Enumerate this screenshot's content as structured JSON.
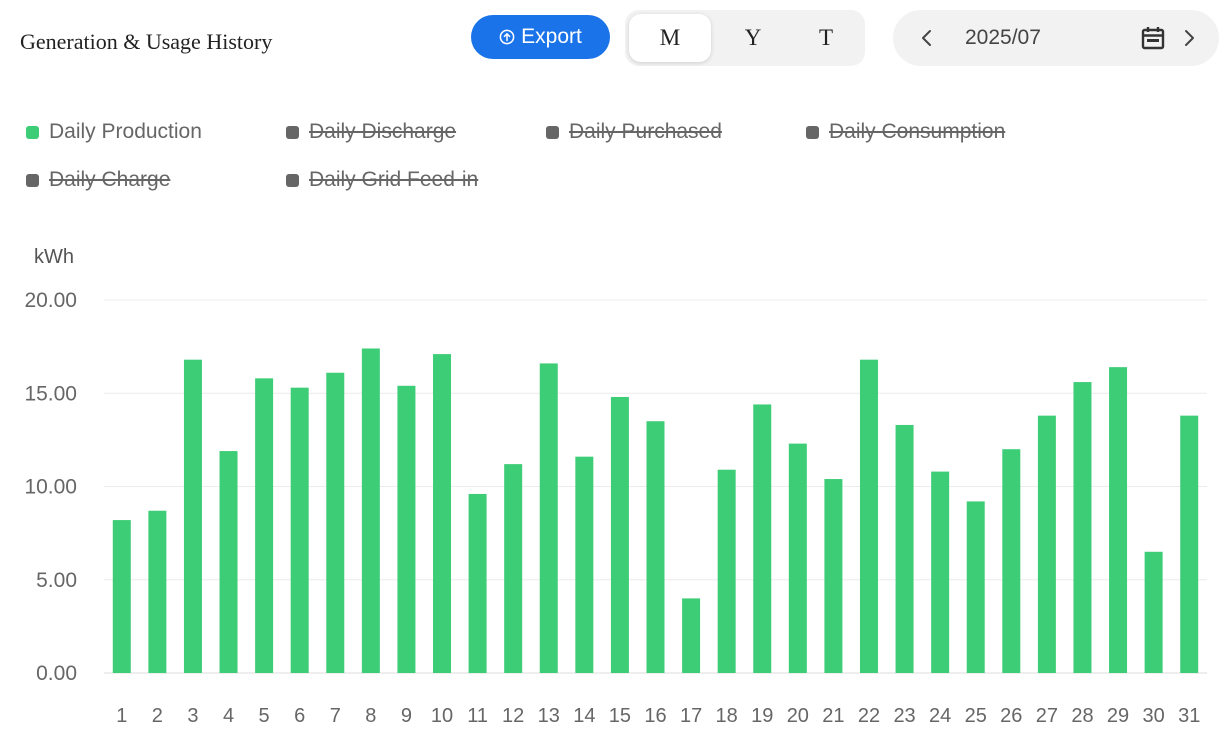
{
  "header": {
    "title": "Generation & Usage History",
    "export_label": "Export",
    "periods": [
      "M",
      "Y",
      "T"
    ],
    "active_period": "M",
    "date": "2025/07"
  },
  "legend": [
    {
      "label": "Daily Production",
      "color": "#3ecd77",
      "enabled": true
    },
    {
      "label": "Daily Discharge",
      "color": "#666666",
      "enabled": false
    },
    {
      "label": "Daily Purchased",
      "color": "#666666",
      "enabled": false
    },
    {
      "label": "Daily Consumption",
      "color": "#666666",
      "enabled": false
    },
    {
      "label": "Daily Charge",
      "color": "#666666",
      "enabled": false
    },
    {
      "label": "Daily Grid Feed-in",
      "color": "#666666",
      "enabled": false
    }
  ],
  "chart_data": {
    "type": "bar",
    "ylabel": "kWh",
    "ylim": [
      0,
      20
    ],
    "yticks": [
      "0.00",
      "5.00",
      "10.00",
      "15.00",
      "20.00"
    ],
    "categories": [
      "1",
      "2",
      "3",
      "4",
      "5",
      "6",
      "7",
      "8",
      "9",
      "10",
      "11",
      "12",
      "13",
      "14",
      "15",
      "16",
      "17",
      "18",
      "19",
      "20",
      "21",
      "22",
      "23",
      "24",
      "25",
      "26",
      "27",
      "28",
      "29",
      "30",
      "31"
    ],
    "series": [
      {
        "name": "Daily Production",
        "color": "#3ecd77",
        "values": [
          8.2,
          8.7,
          16.8,
          11.9,
          15.8,
          15.3,
          16.1,
          17.4,
          15.4,
          17.1,
          9.6,
          11.2,
          16.6,
          11.6,
          14.8,
          13.5,
          4.0,
          10.9,
          14.4,
          12.3,
          10.4,
          16.8,
          13.3,
          10.8,
          9.2,
          12.0,
          13.8,
          15.6,
          16.4,
          6.5,
          13.8
        ]
      }
    ],
    "grid": true,
    "legend_position": "top"
  }
}
